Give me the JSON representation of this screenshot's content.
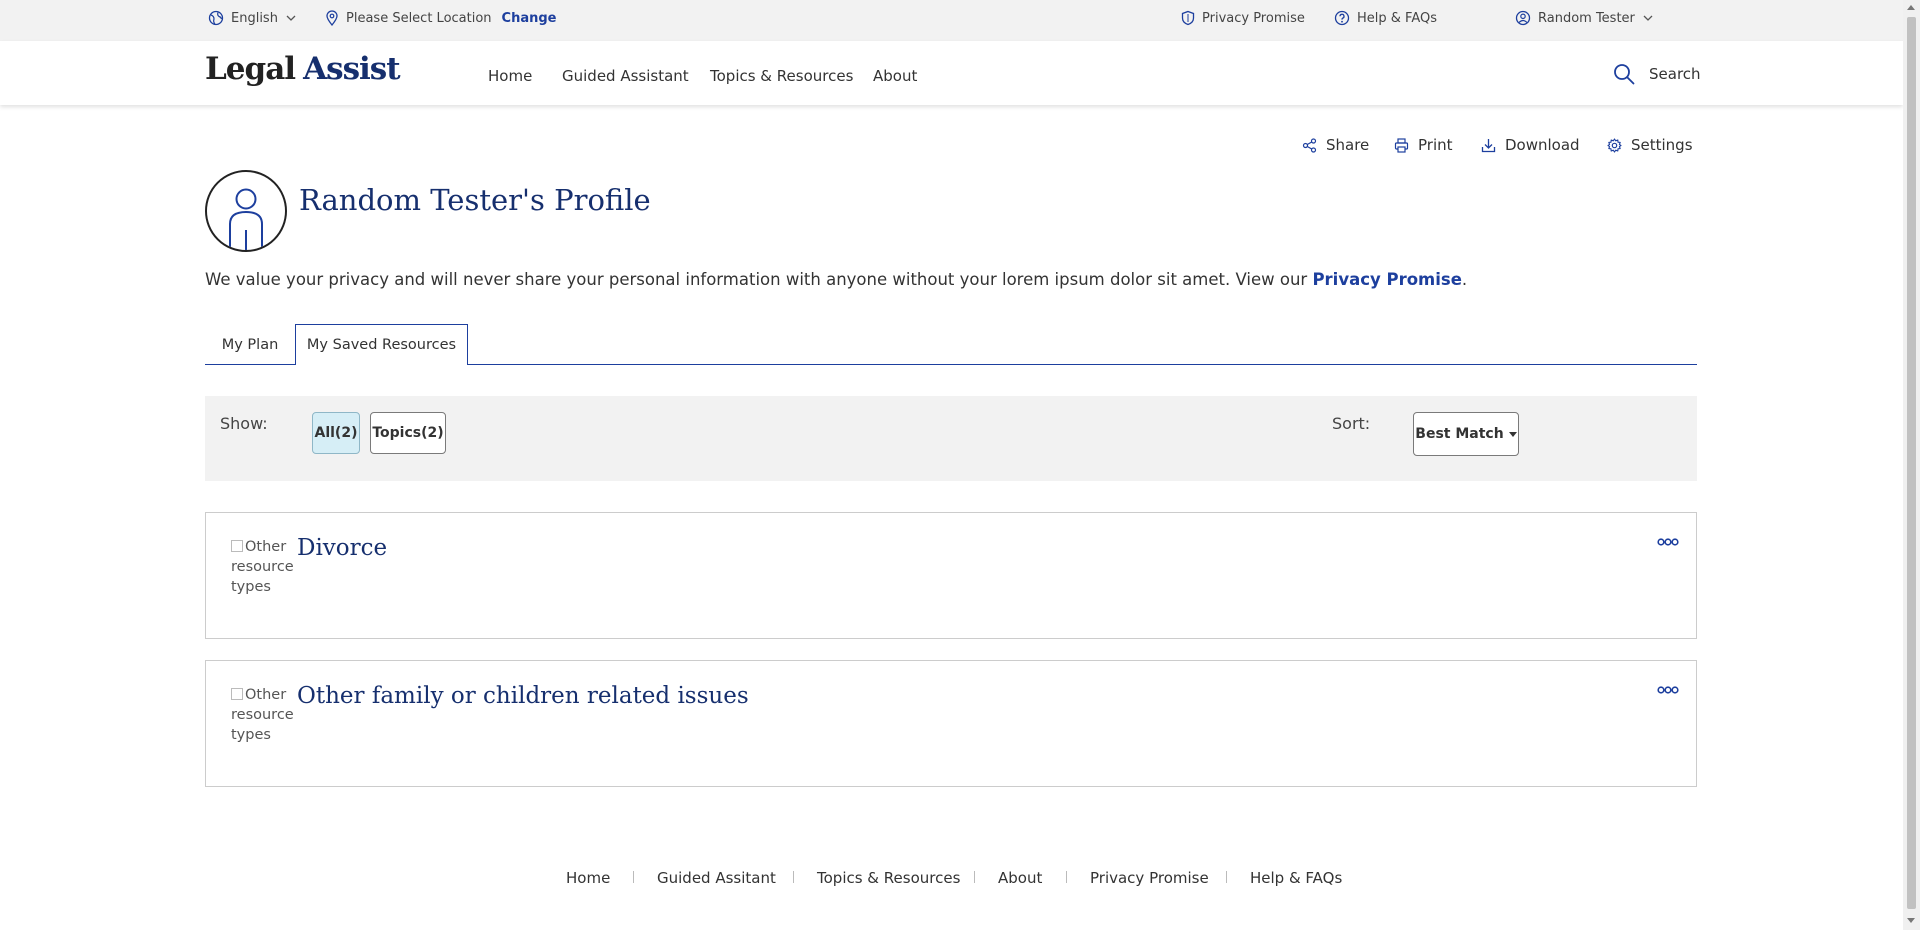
{
  "utility": {
    "language": "English",
    "location_prompt": "Please Select Location",
    "change": "Change",
    "privacy_promise": "Privacy Promise",
    "help": "Help & FAQs",
    "user": "Random Tester"
  },
  "header": {
    "logo_part1": "Legal",
    "logo_part2": "Assist",
    "nav": [
      "Home",
      "Guided Assistant",
      "Topics & Resources",
      "About"
    ],
    "search": "Search"
  },
  "actions": {
    "share": "Share",
    "print": "Print",
    "download": "Download",
    "settings": "Settings"
  },
  "profile": {
    "title": "Random Tester's Profile",
    "privacy_text": "We value your privacy and will never share your personal information with anyone without your lorem ipsum dolor sit amet. View our ",
    "privacy_link": "Privacy Promise",
    "privacy_end": "."
  },
  "tabs": [
    "My Plan",
    "My Saved Resources"
  ],
  "filters": {
    "show_label": "Show:",
    "chips": [
      "All(2)",
      "Topics(2)"
    ],
    "sort_label": "Sort:",
    "sort_value": "Best Match"
  },
  "resources": [
    {
      "title": "Divorce",
      "image_alt": "Other resource types"
    },
    {
      "title": "Other family or children related issues",
      "image_alt": "Other resource types"
    }
  ],
  "footer": [
    "Home",
    "Guided Assitant",
    "Topics & Resources",
    "About",
    "Privacy Promise",
    "Help & FAQs"
  ],
  "colors": {
    "brand_navy": "#162f6e",
    "link_blue": "#1d3f9e",
    "active_chip": "#d6eef6",
    "bar_gray": "#f2f2f2"
  },
  "icons": {
    "language": "globe-icon",
    "location": "map-pin-icon",
    "privacy": "shield-icon",
    "help": "question-circle-icon",
    "user": "user-circle-icon",
    "search": "search-icon",
    "share": "share-icon",
    "print": "printer-icon",
    "download": "download-icon",
    "settings": "gear-icon",
    "more": "more-options-icon"
  }
}
